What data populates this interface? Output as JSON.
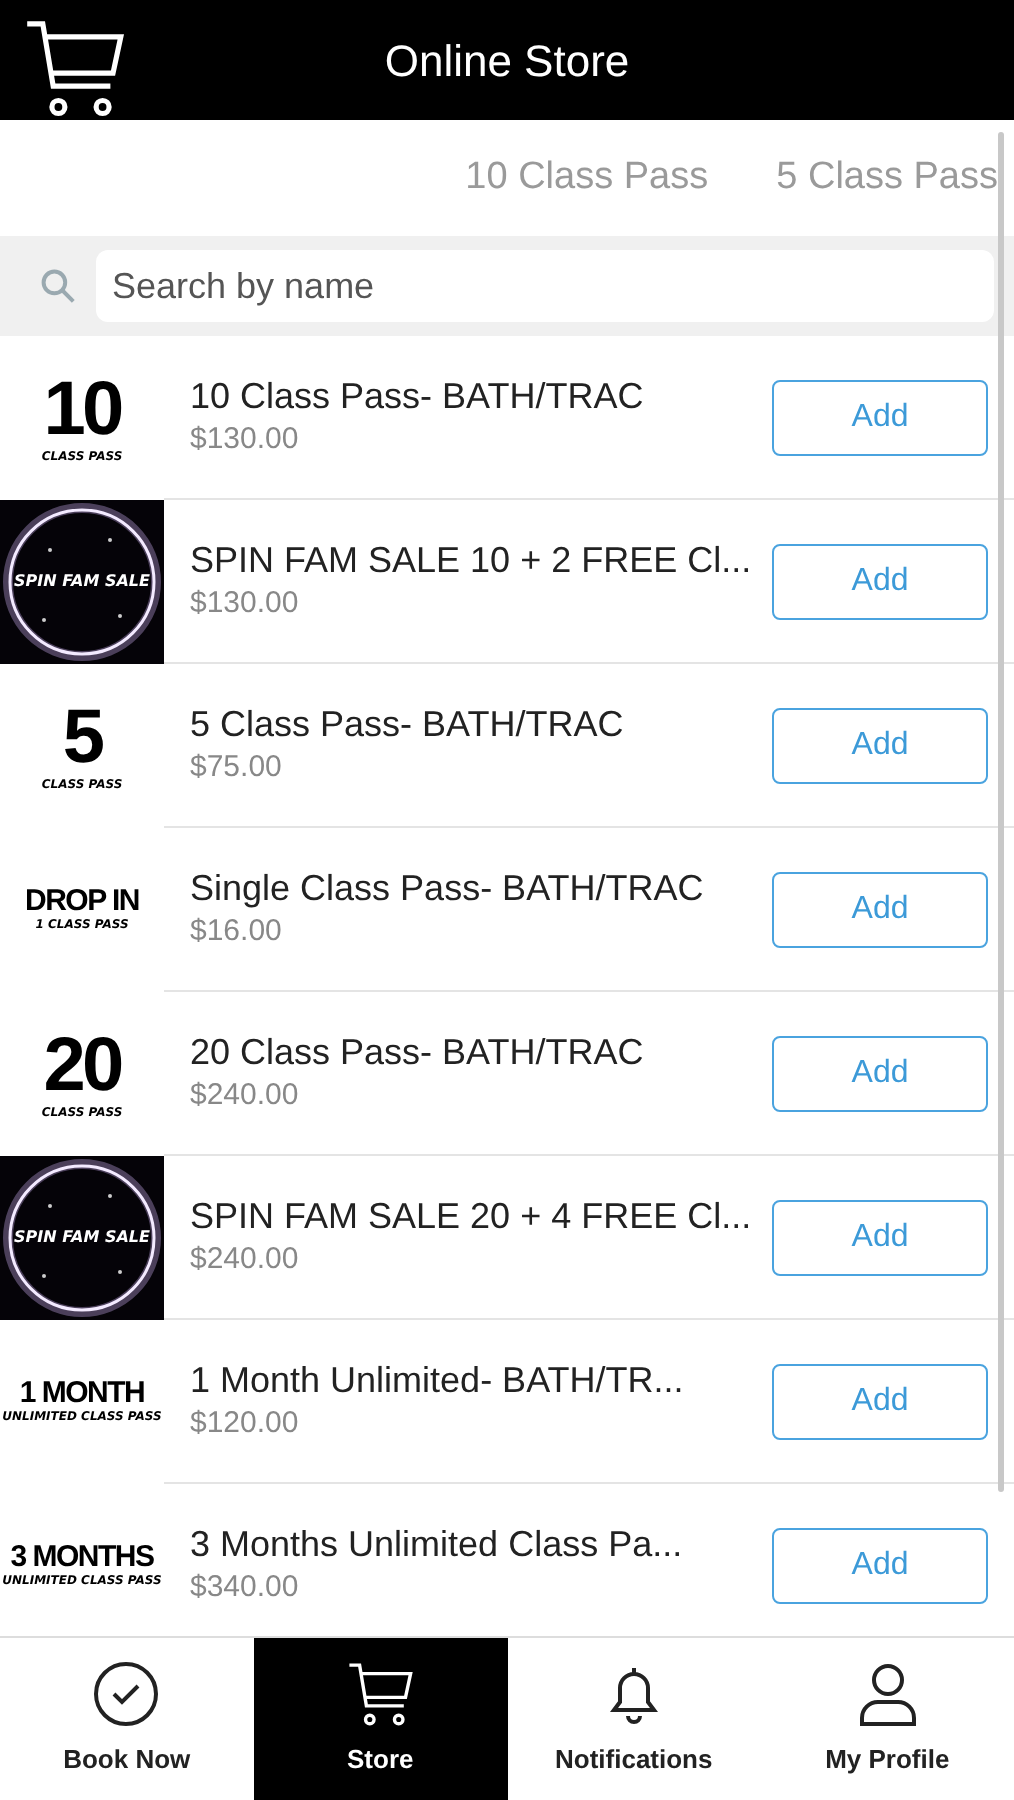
{
  "header": {
    "title": "Online Store"
  },
  "categories": [
    {
      "label": "10 Class Pass",
      "selected": false
    },
    {
      "label": "5 Class Pass",
      "selected": false
    }
  ],
  "search": {
    "placeholder": "Search by name"
  },
  "products": [
    {
      "name": "10 Class Pass- BATH/TRAC",
      "price": "$130.00",
      "thumb": {
        "kind": "text",
        "big": "10",
        "small": "CLASS PASS"
      },
      "button": "Add"
    },
    {
      "name": "SPIN FAM SALE 10 + 2 FREE Cl...",
      "price": "$130.00",
      "thumb": {
        "kind": "neon",
        "big": "SPIN FAM SALE"
      },
      "button": "Add"
    },
    {
      "name": "5 Class Pass- BATH/TRAC",
      "price": "$75.00",
      "thumb": {
        "kind": "text",
        "big": "5",
        "small": "CLASS PASS"
      },
      "button": "Add"
    },
    {
      "name": "Single Class Pass- BATH/TRAC",
      "price": "$16.00",
      "thumb": {
        "kind": "text",
        "big": "DROP IN",
        "small": "1 CLASS PASS"
      },
      "button": "Add"
    },
    {
      "name": "20 Class Pass- BATH/TRAC",
      "price": "$240.00",
      "thumb": {
        "kind": "text",
        "big": "20",
        "small": "CLASS PASS"
      },
      "button": "Add"
    },
    {
      "name": "SPIN FAM SALE 20 + 4 FREE Cl...",
      "price": "$240.00",
      "thumb": {
        "kind": "neon",
        "big": "SPIN FAM SALE"
      },
      "button": "Add"
    },
    {
      "name": "1 Month Unlimited- BATH/TR...",
      "price": "$120.00",
      "thumb": {
        "kind": "text",
        "big": "1 MONTH",
        "small": "UNLIMITED CLASS PASS"
      },
      "button": "Add"
    },
    {
      "name": "3 Months Unlimited Class Pa...",
      "price": "$340.00",
      "thumb": {
        "kind": "text",
        "big": "3 MONTHS",
        "small": "UNLIMITED CLASS PASS"
      },
      "button": "Add"
    }
  ],
  "nav": [
    {
      "label": "Book Now",
      "kind": "check",
      "selected": false
    },
    {
      "label": "Store",
      "kind": "cart",
      "selected": true
    },
    {
      "label": "Notifications",
      "kind": "bell",
      "selected": false
    },
    {
      "label": "My Profile",
      "kind": "user",
      "selected": false
    }
  ]
}
